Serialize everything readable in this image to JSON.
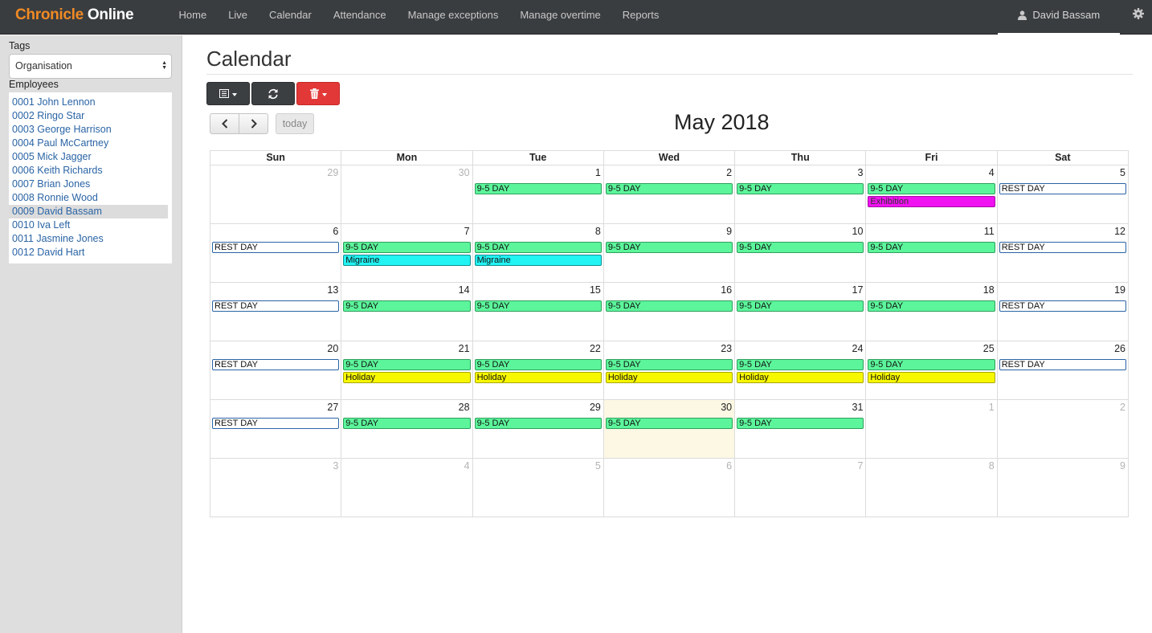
{
  "app": {
    "brand_part1": "Chronicle",
    "brand_part2": "Online"
  },
  "nav": [
    "Home",
    "Live",
    "Calendar",
    "Attendance",
    "Manage exceptions",
    "Manage overtime",
    "Reports"
  ],
  "user": {
    "name": "David Bassam"
  },
  "sidebar": {
    "tags_label": "Tags",
    "tags_value": "Organisation",
    "employees_label": "Employees",
    "employees": [
      "0001 John Lennon",
      "0002 Ringo Star",
      "0003 George Harrison",
      "0004 Paul McCartney",
      "0005 Mick Jagger",
      "0006 Keith Richards",
      "0007 Brian Jones",
      "0008 Ronnie Wood",
      "0009 David Bassam",
      "0010 Iva Left",
      "0011 Jasmine Jones",
      "0012 David Hart"
    ],
    "selected_employee_index": 8
  },
  "page": {
    "title": "Calendar"
  },
  "calendar": {
    "month_title": "May 2018",
    "today_label": "today",
    "weekdays": [
      "Sun",
      "Mon",
      "Tue",
      "Wed",
      "Thu",
      "Fri",
      "Sat"
    ],
    "weeks": [
      [
        {
          "d": "29",
          "other": true,
          "ev": []
        },
        {
          "d": "30",
          "other": true,
          "ev": []
        },
        {
          "d": "1",
          "ev": [
            [
              "9-5 DAY",
              "work"
            ]
          ]
        },
        {
          "d": "2",
          "ev": [
            [
              "9-5 DAY",
              "work"
            ]
          ]
        },
        {
          "d": "3",
          "ev": [
            [
              "9-5 DAY",
              "work"
            ]
          ]
        },
        {
          "d": "4",
          "ev": [
            [
              "9-5 DAY",
              "work"
            ],
            [
              "Exhibition",
              "exhibition"
            ]
          ]
        },
        {
          "d": "5",
          "ev": [
            [
              "REST DAY",
              "rest"
            ]
          ]
        }
      ],
      [
        {
          "d": "6",
          "ev": [
            [
              "REST DAY",
              "rest"
            ]
          ]
        },
        {
          "d": "7",
          "ev": [
            [
              "9-5 DAY",
              "work"
            ],
            [
              "Migraine",
              "migraine"
            ]
          ]
        },
        {
          "d": "8",
          "ev": [
            [
              "9-5 DAY",
              "work"
            ],
            [
              "Migraine",
              "migraine"
            ]
          ]
        },
        {
          "d": "9",
          "ev": [
            [
              "9-5 DAY",
              "work"
            ]
          ]
        },
        {
          "d": "10",
          "ev": [
            [
              "9-5 DAY",
              "work"
            ]
          ]
        },
        {
          "d": "11",
          "ev": [
            [
              "9-5 DAY",
              "work"
            ]
          ]
        },
        {
          "d": "12",
          "ev": [
            [
              "REST DAY",
              "rest"
            ]
          ]
        }
      ],
      [
        {
          "d": "13",
          "ev": [
            [
              "REST DAY",
              "rest"
            ]
          ]
        },
        {
          "d": "14",
          "ev": [
            [
              "9-5 DAY",
              "work"
            ]
          ]
        },
        {
          "d": "15",
          "ev": [
            [
              "9-5 DAY",
              "work"
            ]
          ]
        },
        {
          "d": "16",
          "ev": [
            [
              "9-5 DAY",
              "work"
            ]
          ]
        },
        {
          "d": "17",
          "ev": [
            [
              "9-5 DAY",
              "work"
            ]
          ]
        },
        {
          "d": "18",
          "ev": [
            [
              "9-5 DAY",
              "work"
            ]
          ]
        },
        {
          "d": "19",
          "ev": [
            [
              "REST DAY",
              "rest"
            ]
          ]
        }
      ],
      [
        {
          "d": "20",
          "ev": [
            [
              "REST DAY",
              "rest"
            ]
          ]
        },
        {
          "d": "21",
          "ev": [
            [
              "9-5 DAY",
              "work"
            ],
            [
              "Holiday",
              "holiday"
            ]
          ]
        },
        {
          "d": "22",
          "ev": [
            [
              "9-5 DAY",
              "work"
            ],
            [
              "Holiday",
              "holiday"
            ]
          ]
        },
        {
          "d": "23",
          "ev": [
            [
              "9-5 DAY",
              "work"
            ],
            [
              "Holiday",
              "holiday"
            ]
          ]
        },
        {
          "d": "24",
          "ev": [
            [
              "9-5 DAY",
              "work"
            ],
            [
              "Holiday",
              "holiday"
            ]
          ]
        },
        {
          "d": "25",
          "ev": [
            [
              "9-5 DAY",
              "work"
            ],
            [
              "Holiday",
              "holiday"
            ]
          ]
        },
        {
          "d": "26",
          "ev": [
            [
              "REST DAY",
              "rest"
            ]
          ]
        }
      ],
      [
        {
          "d": "27",
          "ev": [
            [
              "REST DAY",
              "rest"
            ]
          ]
        },
        {
          "d": "28",
          "ev": [
            [
              "9-5 DAY",
              "work"
            ]
          ]
        },
        {
          "d": "29",
          "ev": [
            [
              "9-5 DAY",
              "work"
            ]
          ]
        },
        {
          "d": "30",
          "today": true,
          "ev": [
            [
              "9-5 DAY",
              "work"
            ]
          ]
        },
        {
          "d": "31",
          "ev": [
            [
              "9-5 DAY",
              "work"
            ]
          ]
        },
        {
          "d": "1",
          "other": true,
          "ev": []
        },
        {
          "d": "2",
          "other": true,
          "ev": []
        }
      ],
      [
        {
          "d": "3",
          "other": true,
          "ev": []
        },
        {
          "d": "4",
          "other": true,
          "ev": []
        },
        {
          "d": "5",
          "other": true,
          "ev": []
        },
        {
          "d": "6",
          "other": true,
          "ev": []
        },
        {
          "d": "7",
          "other": true,
          "ev": []
        },
        {
          "d": "8",
          "other": true,
          "ev": []
        },
        {
          "d": "9",
          "other": true,
          "ev": []
        }
      ]
    ]
  },
  "colors": {
    "brand_orange": "#f08a24",
    "work_green": "#5cf59b",
    "holiday_yellow": "#f7f700",
    "migraine_cyan": "#22f3f3",
    "exhibition_magenta": "#f012f0",
    "delete_red": "#e23838",
    "today_highlight": "#fcf8e3"
  },
  "icons": {
    "user": "user-icon",
    "settings": "gear-icon",
    "view": "list-view-icon",
    "refresh": "refresh-icon",
    "delete": "trash-icon",
    "prev": "chevron-left-icon",
    "next": "chevron-right-icon"
  }
}
